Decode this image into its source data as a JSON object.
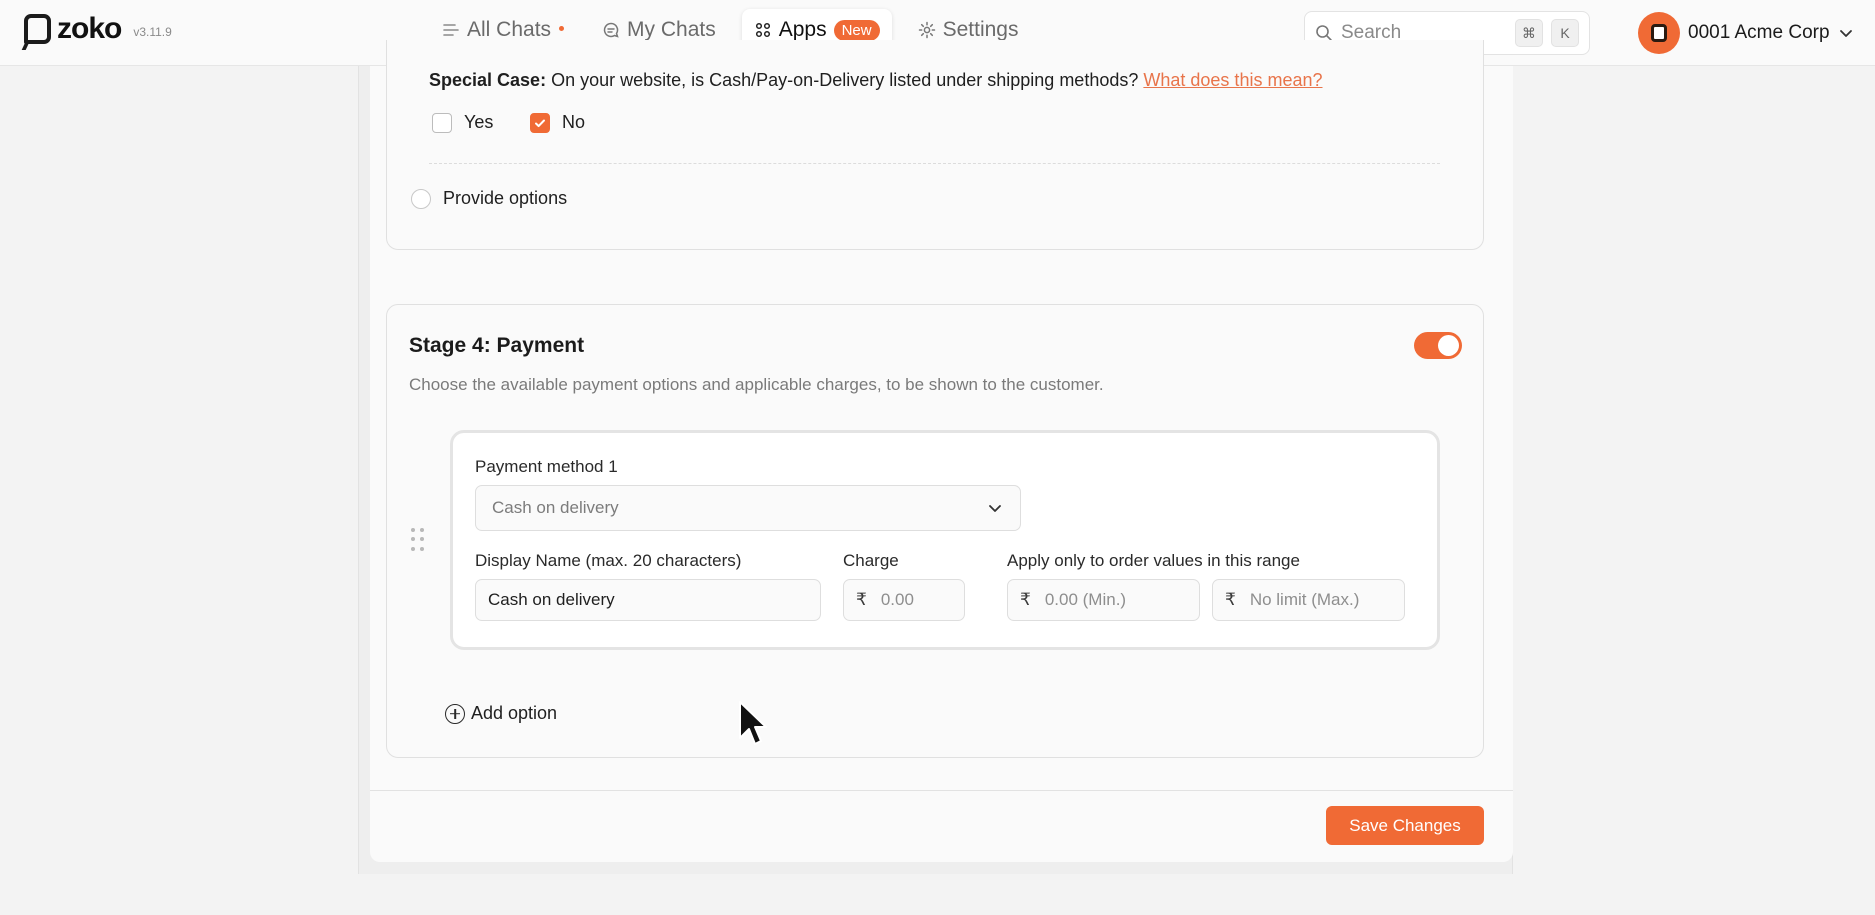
{
  "app": {
    "name": "zoko",
    "version": "v3.11.9"
  },
  "nav": {
    "items": [
      {
        "label": "All Chats",
        "icon": "list-icon",
        "active": false,
        "dot": true
      },
      {
        "label": "My Chats",
        "icon": "chat-bubble-icon",
        "active": false
      },
      {
        "label": "Apps",
        "icon": "grid-icon",
        "active": true,
        "badge": "New"
      },
      {
        "label": "Settings",
        "icon": "gear-icon",
        "active": false
      }
    ]
  },
  "search": {
    "placeholder": "Search",
    "shortcut_keys": [
      "⌘",
      "K"
    ]
  },
  "account": {
    "name": "0001 Acme Corp"
  },
  "shipping": {
    "special_case_bold": "Special Case:",
    "special_case_text": "On your website, is Cash/Pay-on-Delivery listed under shipping methods?",
    "help_link": "What does this mean?",
    "options": [
      {
        "label": "Yes",
        "checked": false
      },
      {
        "label": "No",
        "checked": true
      }
    ],
    "provide_options_label": "Provide options"
  },
  "payment": {
    "title": "Stage 4: Payment",
    "description": "Choose the available payment options and applicable charges, to be shown to the customer.",
    "enabled": true,
    "method": {
      "label": "Payment method 1",
      "selected": "Cash on delivery",
      "display_name_label": "Display Name (max. 20 characters)",
      "display_name_value": "Cash on delivery",
      "charge_label": "Charge",
      "charge_placeholder": "0.00",
      "range_label": "Apply only to order values in this range",
      "min_placeholder": "0.00 (Min.)",
      "max_placeholder": "No limit (Max.)",
      "currency": "₹"
    },
    "add_option_label": "Add option"
  },
  "footer": {
    "save_label": "Save Changes"
  },
  "colors": {
    "accent": "#f06a35",
    "link": "#e8744a"
  }
}
